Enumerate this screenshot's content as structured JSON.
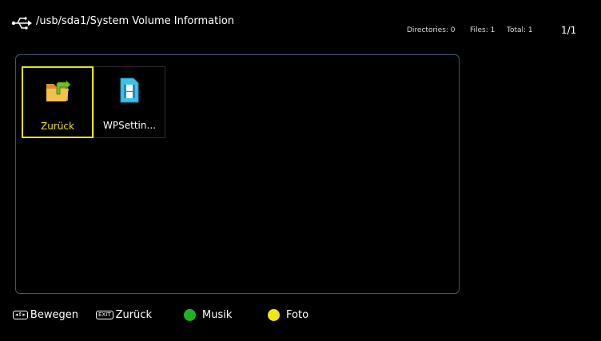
{
  "header": {
    "path": "/usb/sda1/System Volume Information",
    "directories": "Directories: 0",
    "files": "Files: 1",
    "total": "Total: 1",
    "page": "1/1",
    "icon": "usb-icon"
  },
  "items": [
    {
      "label": "Zurück",
      "icon": "folder-back-icon",
      "selected": true
    },
    {
      "label": "WPSettin...",
      "icon": "video-file-icon",
      "selected": false
    }
  ],
  "footer": {
    "move_key": "◂⇕▸",
    "move_label": "Bewegen",
    "exit_key": "EXIT",
    "exit_label": "Zurück",
    "green_label": "Musik",
    "yellow_label": "Foto"
  },
  "colors": {
    "selection": "#e6e21a",
    "green": "#22b022",
    "yellow": "#f0e614",
    "panel_border": "#3f5570"
  }
}
